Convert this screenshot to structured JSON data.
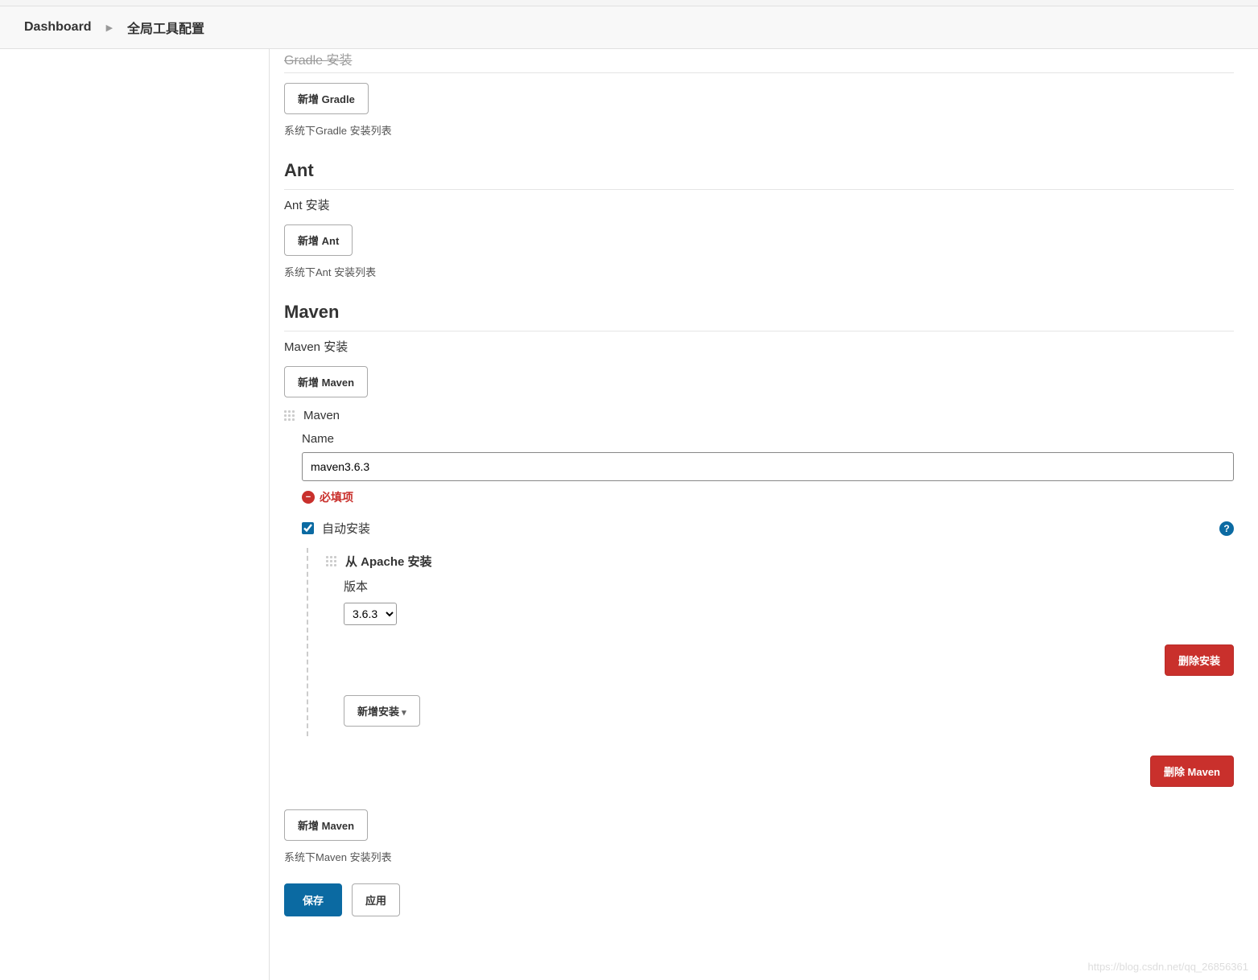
{
  "breadcrumb": {
    "dashboard": "Dashboard",
    "current": "全局工具配置"
  },
  "gradle": {
    "strike_text": "Gradle 安装",
    "add_button": "新增 Gradle",
    "hint": "系统下Gradle 安装列表"
  },
  "ant": {
    "heading": "Ant",
    "sub_label": "Ant 安装",
    "add_button": "新增 Ant",
    "hint": "系统下Ant 安装列表"
  },
  "maven": {
    "heading": "Maven",
    "sub_label": "Maven 安装",
    "add_button_top": "新增 Maven",
    "install_title": "Maven",
    "name_label": "Name",
    "name_value": "maven3.6.3",
    "error_text": "必填项",
    "auto_install_label": "自动安装",
    "auto_install_checked": true,
    "from_apache_label": "从 Apache 安装",
    "version_label": "版本",
    "version_selected": "3.6.3",
    "delete_install_button": "删除安装",
    "add_installer_button": "新增安装",
    "delete_maven_button": "删除 Maven",
    "add_button_bottom": "新增 Maven",
    "hint": "系统下Maven 安装列表"
  },
  "actions": {
    "save": "保存",
    "apply": "应用"
  },
  "watermark": "https://blog.csdn.net/qq_26856361"
}
